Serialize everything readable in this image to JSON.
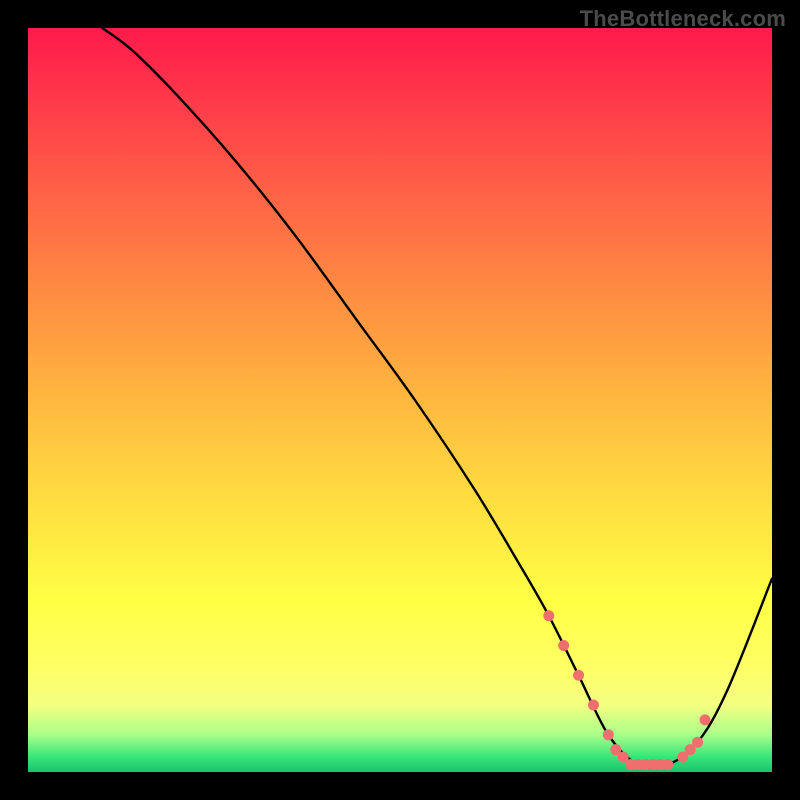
{
  "watermark": "TheBottleneck.com",
  "colors": {
    "frame": "#000000",
    "stroke": "#000000",
    "marker": "#ef6f6e",
    "gradient_stops": [
      "#ff1a4b",
      "#ff3a4a",
      "#ff6146",
      "#ff8a42",
      "#ffb23f",
      "#ffdc40",
      "#ffff44",
      "#ffff66",
      "#f4ff82",
      "#a8ff8a",
      "#37e57a",
      "#19c36a"
    ]
  },
  "chart_data": {
    "type": "line",
    "title": "",
    "xlabel": "",
    "ylabel": "",
    "xlim": [
      0,
      100
    ],
    "ylim": [
      0,
      100
    ],
    "series": [
      {
        "name": "curve",
        "x": [
          10,
          14,
          20,
          28,
          36,
          44,
          52,
          60,
          66,
          70,
          74,
          78,
          82,
          86,
          90,
          94,
          100
        ],
        "y": [
          100,
          97,
          91,
          82,
          72,
          61,
          50,
          38,
          28,
          21,
          13,
          5,
          1,
          1,
          4,
          11,
          26
        ]
      },
      {
        "name": "markers",
        "x": [
          70,
          72,
          74,
          76,
          78,
          79,
          80,
          81,
          82,
          83,
          84,
          85,
          86,
          88,
          89,
          90,
          91
        ],
        "y": [
          21,
          17,
          13,
          9,
          5,
          3,
          2,
          1,
          1,
          1,
          1,
          1,
          1,
          2,
          3,
          4,
          7
        ]
      }
    ],
    "grid": false,
    "legend": false
  }
}
